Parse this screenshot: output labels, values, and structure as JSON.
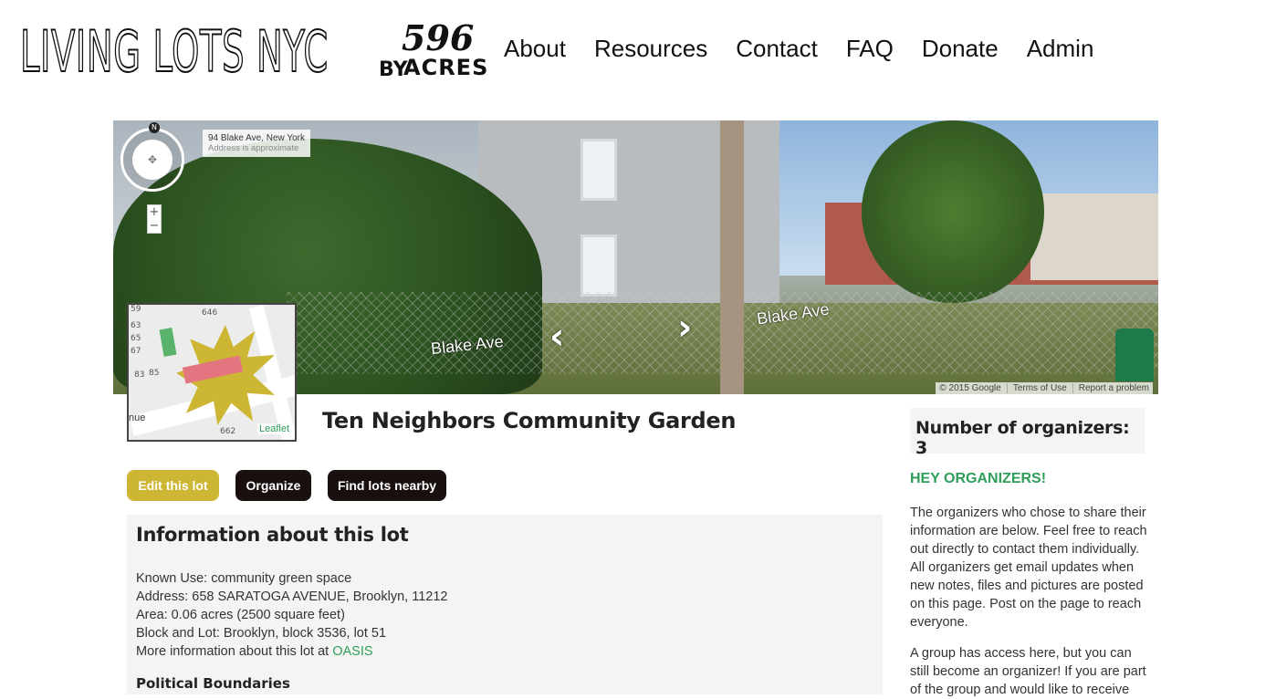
{
  "header": {
    "logo_main": "LIVING LOTS NYC",
    "logo_by": "BY",
    "logo_num": "596",
    "logo_acres": "ACRES",
    "nav": [
      "About",
      "Resources",
      "Contact",
      "FAQ",
      "Donate",
      "Admin"
    ]
  },
  "streetview": {
    "address": "94 Blake Ave, New York",
    "address_note": "Address is approximate",
    "street_label_left": "Blake Ave",
    "street_label_right": "Blake Ave",
    "compass_n": "N",
    "zoom_in": "+",
    "zoom_out": "−",
    "copyright": "© 2015 Google",
    "terms": "Terms of Use",
    "report": "Report a problem"
  },
  "minimap": {
    "lot_numbers": [
      "59",
      "646",
      "63",
      "65",
      "67",
      "83",
      "85",
      "662"
    ],
    "street_fragment": "nue",
    "attribution": "Leaflet"
  },
  "lot": {
    "title": "Ten Neighbors Community Garden",
    "buttons": {
      "edit": "Edit this lot",
      "organize": "Organize",
      "find": "Find lots nearby"
    }
  },
  "info": {
    "heading": "Information about this lot",
    "known_use": "Known Use: community green space",
    "address": "Address: 658 SARATOGA AVENUE, Brooklyn, 11212",
    "area": "Area: 0.06 acres (2500 square feet)",
    "block_lot": "Block and Lot: Brooklyn, block 3536, lot 51",
    "more_info_prefix": "More information about this lot at ",
    "more_info_link": "OASIS",
    "political_heading": "Political Boundaries"
  },
  "sidebar": {
    "organizer_count": "Number of organizers: 3",
    "hey_heading": "HEY ORGANIZERS!",
    "para1": "The organizers who chose to share their information are below. Feel free to reach out directly to contact them individually. All organizers get email updates when new notes, files and pictures are posted on this page. Post on the page to reach everyone.",
    "para2": "A group has access here, but you can still become an organizer! If you are part of the group and would like to receive"
  },
  "colors": {
    "accent_gold": "#cdb634",
    "accent_green": "#2e9e5a",
    "button_dark": "#1a0f0f",
    "panel_bg": "#f4f5f3"
  }
}
